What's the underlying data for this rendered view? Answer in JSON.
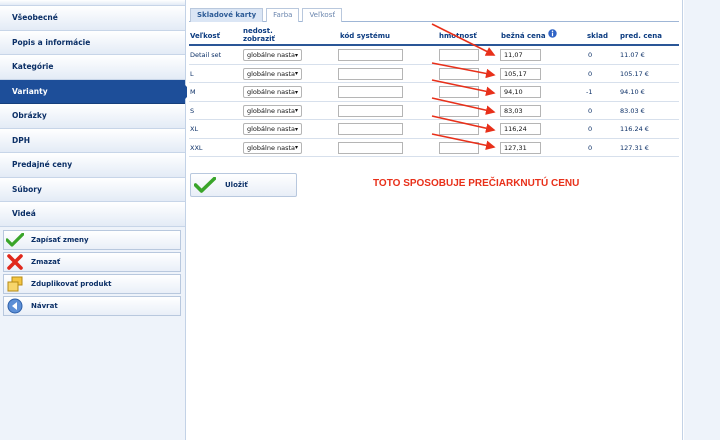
{
  "sidebar": {
    "items": [
      {
        "label": "Všeobecné",
        "active": false
      },
      {
        "label": "Popis a informácie",
        "active": false
      },
      {
        "label": "Kategórie",
        "active": false
      },
      {
        "label": "Varianty",
        "active": true
      },
      {
        "label": "Obrázky",
        "active": false
      },
      {
        "label": "DPH",
        "active": false
      },
      {
        "label": "Predajné ceny",
        "active": false
      },
      {
        "label": "Súbory",
        "active": false
      },
      {
        "label": "Videá",
        "active": false
      }
    ],
    "actions": [
      {
        "label": "Zapísať zmeny",
        "icon": "check-icon"
      },
      {
        "label": "Zmazať",
        "icon": "delete-x-icon"
      },
      {
        "label": "Zduplikovať produkt",
        "icon": "duplicate-boxes-icon"
      },
      {
        "label": "Návrat",
        "icon": "back-arrow-icon"
      }
    ]
  },
  "tabs": [
    {
      "label": "Skladové karty",
      "active": true
    },
    {
      "label": "Farba",
      "active": false
    },
    {
      "label": "Veľkosť",
      "active": false
    }
  ],
  "table": {
    "headers": {
      "size": "Veľkosť",
      "not_available_line1": "nedost.",
      "not_available_line2": "zobraziť",
      "system_code": "kód systému",
      "weight": "hmotnosť",
      "regular_price": "bežná cena",
      "stock": "sklad",
      "sale_price": "pred. cena"
    },
    "info_icon": "info-icon",
    "rows": [
      {
        "size": "Detail set",
        "visibility": "globálne nasta",
        "code": "",
        "weight": "",
        "price": "11,07",
        "stock": "0",
        "sale": "11.07 €"
      },
      {
        "size": "L",
        "visibility": "globálne nasta",
        "code": "",
        "weight": "",
        "price": "105,17",
        "stock": "0",
        "sale": "105.17 €"
      },
      {
        "size": "M",
        "visibility": "globálne nasta",
        "code": "",
        "weight": "",
        "price": "94,10",
        "stock": "-1",
        "sale": "94.10 €"
      },
      {
        "size": "S",
        "visibility": "globálne nasta",
        "code": "",
        "weight": "",
        "price": "83,03",
        "stock": "0",
        "sale": "83.03 €"
      },
      {
        "size": "XL",
        "visibility": "globálne nasta",
        "code": "",
        "weight": "",
        "price": "116,24",
        "stock": "0",
        "sale": "116.24 €"
      },
      {
        "size": "XXL",
        "visibility": "globálne nasta",
        "code": "",
        "weight": "",
        "price": "127,31",
        "stock": "0",
        "sale": "127.31 €"
      }
    ]
  },
  "save_button": {
    "label": "Uložiť",
    "icon": "check-icon"
  },
  "annotation": {
    "text": "TOTO SPOSOBUJE PREČIARKNUTÚ CENU",
    "color": "#e8301a"
  },
  "colors": {
    "accent": "#1d4e99",
    "arrow": "#e8301a"
  }
}
